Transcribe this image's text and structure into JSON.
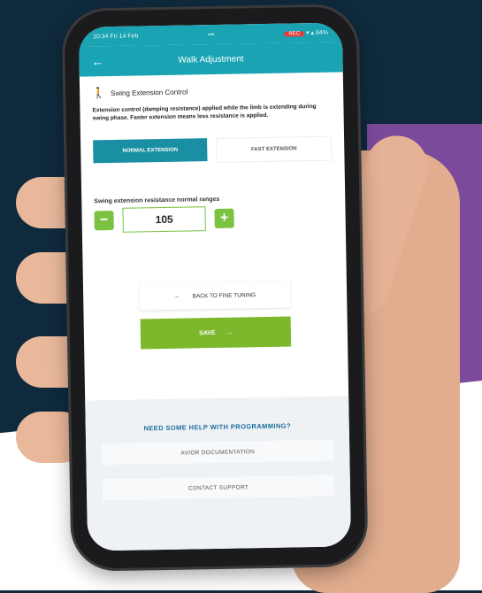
{
  "status_bar": {
    "left_text": "10:34  Fri 14 Feb",
    "center_text": "•••",
    "right_text": "▾ ▴ 84%",
    "badge_text": "REC"
  },
  "app_bar": {
    "back_icon": "arrow-left-icon",
    "title": "Walk Adjustment"
  },
  "section": {
    "icon": "walking-person-icon",
    "heading": "Swing Extension Control",
    "description": "Extension control (damping resistance) applied while the limb is extending during swing phase. Faster extension means less resistance is applied."
  },
  "toggle": {
    "normal_label": "NORMAL EXTENSION",
    "fast_label": "FAST EXTENSION",
    "selected": "normal"
  },
  "resistance": {
    "label": "Swing extension resistance normal ranges",
    "value": "105",
    "minus_label": "−",
    "plus_label": "+"
  },
  "actions": {
    "back_label": "BACK TO FINE TUNING",
    "back_arrow": "←",
    "save_label": "SAVE",
    "save_arrow": "→"
  },
  "help": {
    "title": "NEED SOME HELP WITH PROGRAMMING?",
    "documentation_label": "AVIOR DOCUMENTATION",
    "support_label": "CONTACT SUPPORT"
  },
  "colors": {
    "accent": "#1aa3b2",
    "active_tab": "#1a8fa3",
    "green": "#7cb82c",
    "help_title": "#1a6b9a",
    "background_dark": "#0f2a3d",
    "background_purple": "#7b4a9a"
  }
}
